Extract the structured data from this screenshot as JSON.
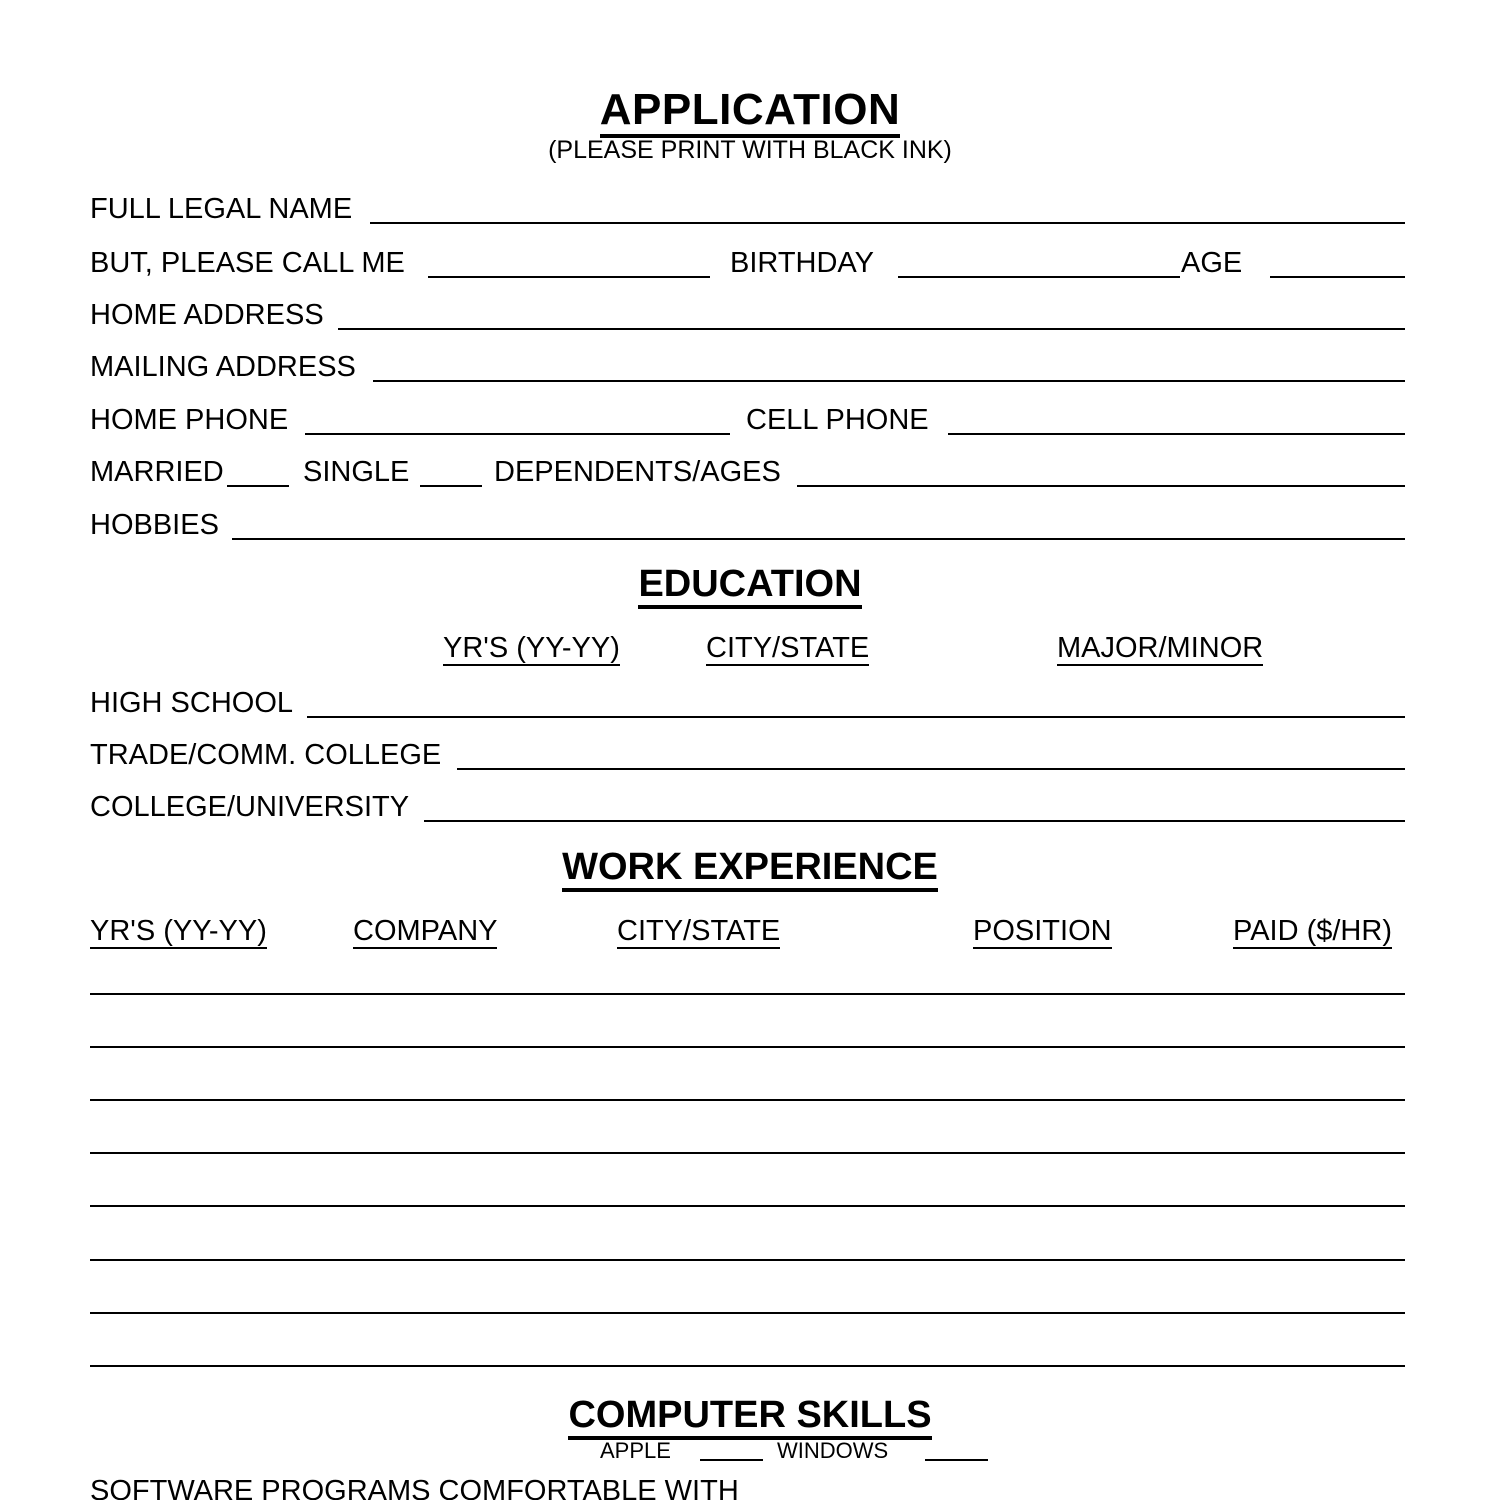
{
  "document": {
    "title": "APPLICATION",
    "subtitle": "(PLEASE PRINT WITH BLACK INK)"
  },
  "personal": {
    "full_legal_name_label": "FULL LEGAL NAME",
    "call_me_label": "BUT, PLEASE CALL ME",
    "birthday_label": "BIRTHDAY",
    "age_label": "AGE",
    "home_address_label": "HOME ADDRESS",
    "mailing_address_label": "MAILING ADDRESS",
    "home_phone_label": "HOME PHONE",
    "cell_phone_label": "CELL PHONE",
    "married_label": "MARRIED",
    "single_label": "SINGLE",
    "dependents_label": "DEPENDENTS/AGES",
    "hobbies_label": "HOBBIES"
  },
  "education": {
    "heading": "EDUCATION",
    "columns": [
      "YR'S (YY-YY)",
      "CITY/STATE",
      "MAJOR/MINOR"
    ],
    "rows": [
      "HIGH SCHOOL",
      "TRADE/COMM. COLLEGE",
      "COLLEGE/UNIVERSITY"
    ]
  },
  "work_experience": {
    "heading": "WORK EXPERIENCE",
    "columns": [
      "YR'S (YY-YY)",
      "COMPANY",
      "CITY/STATE",
      "POSITION",
      "PAID ($/HR)"
    ],
    "blank_row_count": 8
  },
  "computer_skills": {
    "heading": "COMPUTER SKILLS",
    "apple_label": "APPLE",
    "windows_label": "WINDOWS",
    "software_label": "SOFTWARE PROGRAMS COMFORTABLE WITH"
  },
  "colors": {
    "ink": "#000000",
    "paper": "#ffffff"
  }
}
